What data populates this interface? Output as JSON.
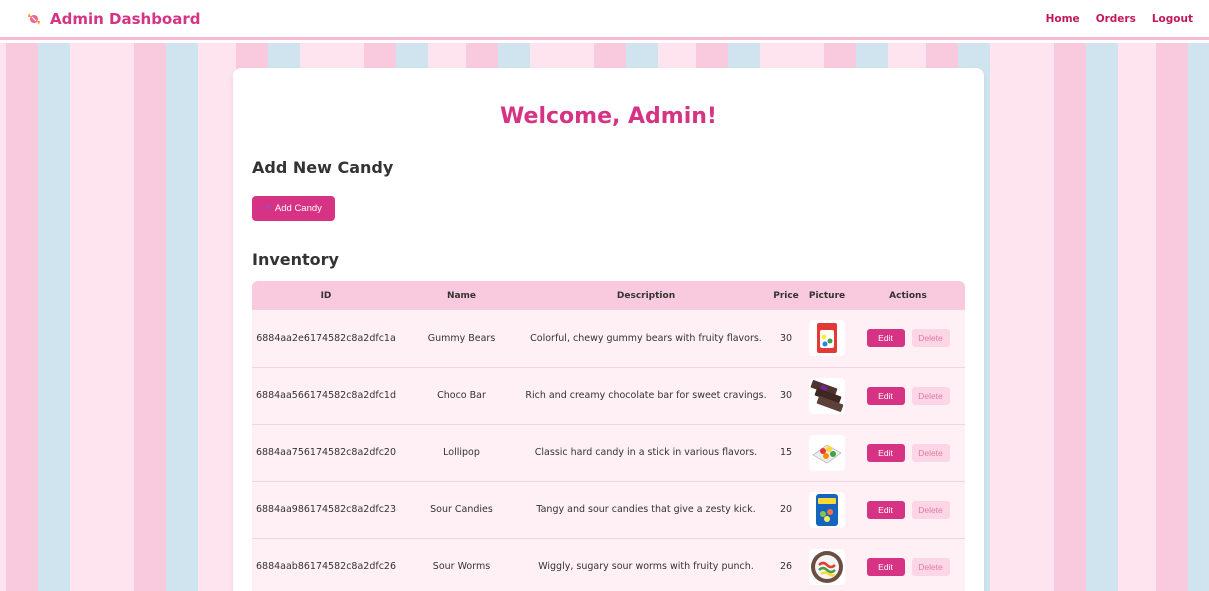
{
  "nav": {
    "brand": "Admin Dashboard",
    "brand_icon": "candy-icon",
    "links": [
      "Home",
      "Orders",
      "Logout"
    ]
  },
  "welcome": "Welcome, Admin!",
  "add_section": {
    "title": "Add New Candy",
    "button_label": "Add Candy",
    "button_icon": "plus-icon"
  },
  "inventory": {
    "title": "Inventory",
    "columns": [
      "ID",
      "Name",
      "Description",
      "Price",
      "Picture",
      "Actions"
    ],
    "rows": [
      {
        "id": "6884aa2e6174582c8a2dfc1a",
        "name": "Gummy Bears",
        "description": "Colorful, chewy gummy bears with fruity flavors.",
        "price": "30",
        "edit": "Edit",
        "delete": "Delete"
      },
      {
        "id": "6884aa566174582c8a2dfc1d",
        "name": "Choco Bar",
        "description": "Rich and creamy chocolate bar for sweet cravings.",
        "price": "30",
        "edit": "Edit",
        "delete": "Delete"
      },
      {
        "id": "6884aa756174582c8a2dfc20",
        "name": "Lollipop",
        "description": "Classic hard candy in a stick in various flavors.",
        "price": "15",
        "edit": "Edit",
        "delete": "Delete"
      },
      {
        "id": "6884aa986174582c8a2dfc23",
        "name": "Sour Candies",
        "description": "Tangy and sour candies that give a zesty kick.",
        "price": "20",
        "edit": "Edit",
        "delete": "Delete"
      },
      {
        "id": "6884aab86174582c8a2dfc26",
        "name": "Sour Worms",
        "description": "Wiggly, sugary sour worms with fruity punch.",
        "price": "26",
        "edit": "Edit",
        "delete": "Delete"
      }
    ]
  },
  "colors": {
    "accent": "#d63384",
    "stripe_pink": "#f9cadd",
    "stripe_blue": "#cfe4ee"
  }
}
